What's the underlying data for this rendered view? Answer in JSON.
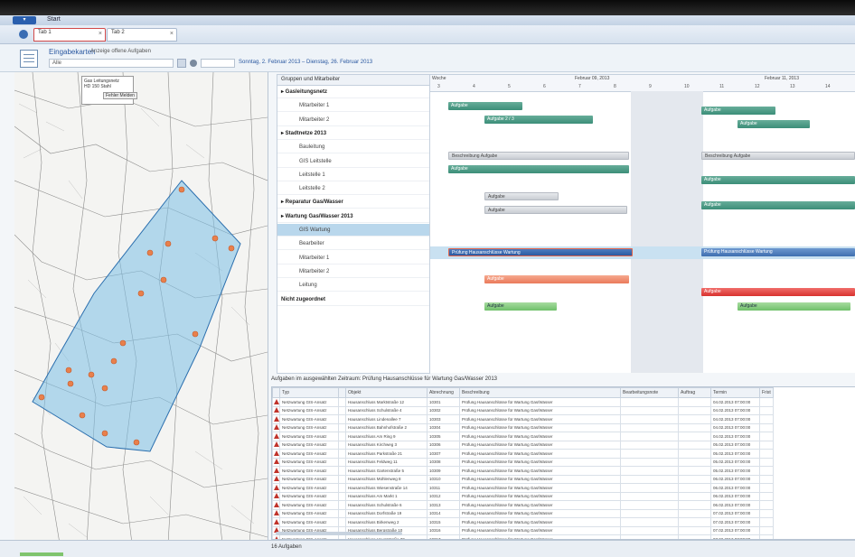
{
  "app": {
    "menu_label": "Start"
  },
  "tabs": [
    {
      "label": "Tab 1",
      "close": "×"
    },
    {
      "label": "Tab 2",
      "close": "×"
    }
  ],
  "module": {
    "title": "Eingabekarten",
    "subtitle": "Anzeige offene Aufgaben",
    "filter_value": "Alle",
    "date_range": "Sonntag, 2. Februar 2013 – Dienstag, 26. Februar 2013"
  },
  "map": {
    "popup_lines": [
      "Gas Leitungsnetz",
      "HD 150 Stahl",
      "Bauabschnitt 3"
    ],
    "popup_button": "Fehler Melden"
  },
  "tree": {
    "header": "Gruppen und Mitarbeiter",
    "rows": [
      {
        "label": "▸ Gasleitungsnetz",
        "type": "group"
      },
      {
        "label": "Mitarbeiter 1",
        "type": "child"
      },
      {
        "label": "Mitarbeiter 2",
        "type": "child"
      },
      {
        "label": "▸ Stadtnetze 2013",
        "type": "group"
      },
      {
        "label": "Bauleitung",
        "type": "child"
      },
      {
        "label": "GIS Leitstelle",
        "type": "child"
      },
      {
        "label": "Leitstelle 1",
        "type": "child"
      },
      {
        "label": "Leitstelle 2",
        "type": "child"
      },
      {
        "label": "▸ Reparatur Gas/Wasser",
        "type": "group"
      },
      {
        "label": "▸ Wartung Gas/Wasser 2013",
        "type": "group"
      },
      {
        "label": "GIS Wartung",
        "type": "child",
        "selected": true
      },
      {
        "label": "Bearbeiter",
        "type": "child"
      },
      {
        "label": "Mitarbeiter 1",
        "type": "child"
      },
      {
        "label": "Mitarbeiter 2",
        "type": "child"
      },
      {
        "label": "Leitung",
        "type": "child"
      },
      {
        "label": "Nicht zugeordnet",
        "type": "group"
      }
    ]
  },
  "gantt": {
    "header_left": "Woche",
    "week1": "Februar 09, 2013",
    "week2": "Februar 11, 2013",
    "days": [
      "3",
      "4",
      "5",
      "6",
      "7",
      "8",
      "9",
      "10",
      "11",
      "12",
      "13",
      "14"
    ],
    "bars": [
      {
        "label": "Aufgabe",
        "color": "teal"
      },
      {
        "label": "Aufgabe 2 / 3",
        "color": "teal"
      },
      {
        "label": "Beschreibung Aufgabe",
        "color": "gray"
      },
      {
        "label": "Aufgabe",
        "color": "teal"
      },
      {
        "label": "Aufgabe",
        "color": "gray"
      },
      {
        "label": "Aufgabe",
        "color": "gray"
      },
      {
        "label": "Prüfung Hausanschlüsse Wartung",
        "color": "navy"
      },
      {
        "label": "Aufgabe",
        "color": "orange"
      },
      {
        "label": "Aufgabe",
        "color": "green"
      },
      {
        "label": "Aufgabe",
        "color": "teal"
      },
      {
        "label": "Aufgabe",
        "color": "teal"
      },
      {
        "label": "Beschreibung Aufgabe",
        "color": "gray"
      },
      {
        "label": "Aufgabe",
        "color": "teal"
      },
      {
        "label": "Aufgabe",
        "color": "teal"
      },
      {
        "label": "Prüfung Hausanschlüsse Wartung",
        "color": "blue"
      },
      {
        "label": "Aufgabe",
        "color": "red"
      },
      {
        "label": "Aufgabe",
        "color": "green"
      }
    ]
  },
  "tasks": {
    "title": "Aufgaben im ausgewählten Zeitraum: Prüfung Hausanschlüsse für Wartung Gas/Wasser 2013",
    "columns": [
      "",
      "Typ",
      "",
      "Objekt",
      "Abrechnung",
      "Beschreibung",
      "Bearbeitungsnote",
      "Auftrag",
      "Termin",
      "Frist"
    ],
    "rows": [
      [
        "Netzwartung GIS-Ansatz",
        "Hausanschluss Marktstraße 12",
        "10301",
        "Prüfung Hausanschlüsse für Wartung Gas/Wasser",
        "",
        "",
        "04.02.2013 07:00:00",
        ""
      ],
      [
        "Netzwartung GIS-Ansatz",
        "Hausanschluss Schulstraße 4",
        "10302",
        "Prüfung Hausanschlüsse für Wartung Gas/Wasser",
        "",
        "",
        "04.02.2013 07:00:00",
        ""
      ],
      [
        "Netzwartung GIS-Ansatz",
        "Hausanschluss Lindenallee 7",
        "10303",
        "Prüfung Hausanschlüsse für Wartung Gas/Wasser",
        "",
        "",
        "04.02.2013 07:00:00",
        ""
      ],
      [
        "Netzwartung GIS-Ansatz",
        "Hausanschluss Bahnhofstraße 2",
        "10304",
        "Prüfung Hausanschlüsse für Wartung Gas/Wasser",
        "",
        "",
        "04.02.2013 07:00:00",
        ""
      ],
      [
        "Netzwartung GIS-Ansatz",
        "Hausanschluss Am Ring 9",
        "10305",
        "Prüfung Hausanschlüsse für Wartung Gas/Wasser",
        "",
        "",
        "04.02.2013 07:00:00",
        ""
      ],
      [
        "Netzwartung GIS-Ansatz",
        "Hausanschluss Kirchweg 3",
        "10306",
        "Prüfung Hausanschlüsse für Wartung Gas/Wasser",
        "",
        "",
        "05.02.2013 07:00:00",
        ""
      ],
      [
        "Netzwartung GIS-Ansatz",
        "Hausanschluss Parkstraße 21",
        "10307",
        "Prüfung Hausanschlüsse für Wartung Gas/Wasser",
        "",
        "",
        "05.02.2013 07:00:00",
        ""
      ],
      [
        "Netzwartung GIS-Ansatz",
        "Hausanschluss Feldweg 11",
        "10308",
        "Prüfung Hausanschlüsse für Wartung Gas/Wasser",
        "",
        "",
        "05.02.2013 07:00:00",
        ""
      ],
      [
        "Netzwartung GIS-Ansatz",
        "Hausanschluss Gartenstraße 5",
        "10309",
        "Prüfung Hausanschlüsse für Wartung Gas/Wasser",
        "",
        "",
        "05.02.2013 07:00:00",
        ""
      ],
      [
        "Netzwartung GIS-Ansatz",
        "Hausanschluss Mühlenweg 8",
        "10310",
        "Prüfung Hausanschlüsse für Wartung Gas/Wasser",
        "",
        "",
        "06.02.2013 07:00:00",
        ""
      ],
      [
        "Netzwartung GIS-Ansatz",
        "Hausanschluss Wiesenstraße 14",
        "10311",
        "Prüfung Hausanschlüsse für Wartung Gas/Wasser",
        "",
        "",
        "06.02.2013 07:00:00",
        ""
      ],
      [
        "Netzwartung GIS-Ansatz",
        "Hausanschluss Am Markt 1",
        "10312",
        "Prüfung Hausanschlüsse für Wartung Gas/Wasser",
        "",
        "",
        "06.02.2013 07:00:00",
        ""
      ],
      [
        "Netzwartung GIS-Ansatz",
        "Hausanschluss Schulstraße 6",
        "10313",
        "Prüfung Hausanschlüsse für Wartung Gas/Wasser",
        "",
        "",
        "06.02.2013 07:00:00",
        ""
      ],
      [
        "Netzwartung GIS-Ansatz",
        "Hausanschluss Dorfstraße 19",
        "10314",
        "Prüfung Hausanschlüsse für Wartung Gas/Wasser",
        "",
        "",
        "07.02.2013 07:00:00",
        ""
      ],
      [
        "Netzwartung GIS-Ansatz",
        "Hausanschluss Birkenweg 2",
        "10315",
        "Prüfung Hausanschlüsse für Wartung Gas/Wasser",
        "",
        "",
        "07.02.2013 07:00:00",
        ""
      ],
      [
        "Netzwartung GIS-Ansatz",
        "Hausanschluss Bergstraße 10",
        "10316",
        "Prüfung Hausanschlüsse für Wartung Gas/Wasser",
        "",
        "",
        "07.02.2013 07:00:00",
        ""
      ],
      [
        "Netzwartung GIS-Ansatz",
        "Hausanschluss Hauptstraße 30",
        "10317",
        "Prüfung Hausanschlüsse für Wartung Gas/Wasser",
        "",
        "",
        "07.02.2013 07:00:00",
        ""
      ]
    ]
  },
  "status": {
    "text": "16 Aufgaben"
  }
}
